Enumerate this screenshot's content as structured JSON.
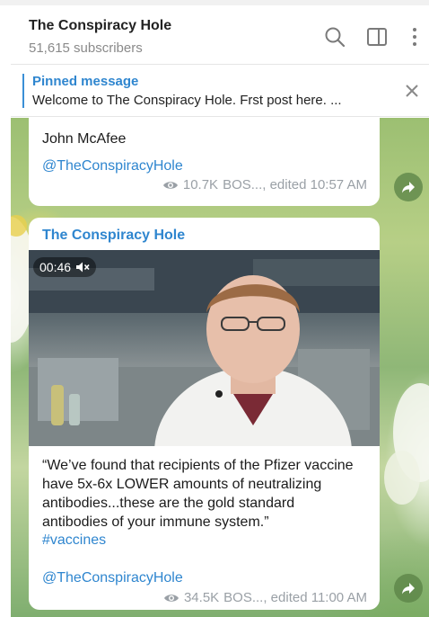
{
  "header": {
    "title": "The Conspiracy Hole",
    "subscribers": "51,615 subscribers",
    "icons": [
      "search-icon",
      "sidebar-toggle-icon",
      "more-vertical-icon"
    ]
  },
  "pinned": {
    "title": "Pinned message",
    "text": "Welcome to The Conspiracy Hole.  Frst post here. ...",
    "close_icon": "close-icon"
  },
  "messages": [
    {
      "text": "John McAfee",
      "link": "@TheConspiracyHole",
      "views": "10.7K",
      "meta": "BOS..., edited 10:57 AM"
    },
    {
      "sender": "The Conspiracy Hole",
      "video": {
        "duration": "00:46",
        "muted_icon": "muted-speaker-icon"
      },
      "lines": [
        "“We’ve found that recipients of the Pfizer vaccine",
        "have 5x-6x LOWER amounts of neutralizing",
        "antibodies...these are the gold standard",
        "antibodies of your immune system.”"
      ],
      "hashtag": "#vaccines",
      "link": "@TheConspiracyHole",
      "views": "34.5K",
      "meta": "BOS..., edited 11:00 AM"
    }
  ],
  "colors": {
    "accent": "#2f86cf",
    "bubble": "#ffffff",
    "meta": "#9aa0a6"
  }
}
